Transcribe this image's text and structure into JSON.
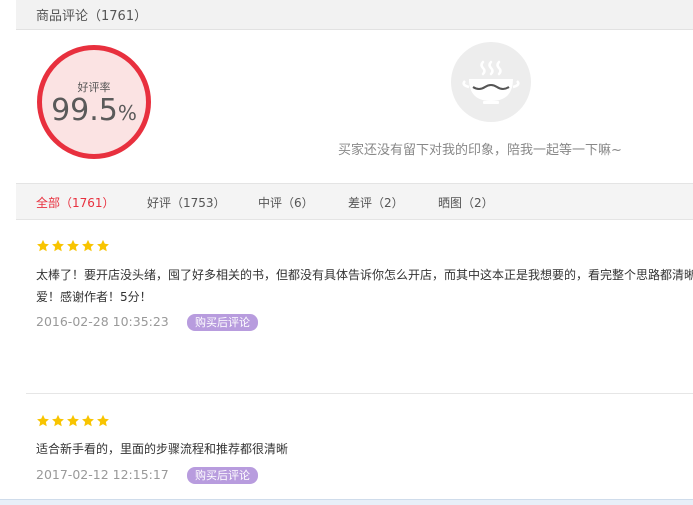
{
  "header": {
    "title": "商品评论（1761）"
  },
  "summary": {
    "rate_label": "好评率",
    "rate_value": "99.5",
    "rate_unit": "%",
    "empty_message": "买家还没有留下对我的印象，陪我一起等一下嘛~",
    "accent_color": "#e8303e"
  },
  "tabs": [
    {
      "label": "全部（1761）",
      "active": true
    },
    {
      "label": "好评（1753）"
    },
    {
      "label": "中评（6）"
    },
    {
      "label": "差评（2）"
    },
    {
      "label": "晒图（2）"
    }
  ],
  "reviews": [
    {
      "stars": 5,
      "text_line1": "太棒了！要开店没头绪，囤了好多相关的书，但都没有具体告诉你怎么开店，而其中这本正是我想要的，看完整个思路都清晰",
      "text_line2": "爱！感谢作者！5分！",
      "date": "2016-02-28 10:35:23",
      "badge": "购买后评论"
    },
    {
      "stars": 5,
      "text_line1": "适合新手看的，里面的步骤流程和推荐都很清晰",
      "date": "2017-02-12 12:15:17",
      "badge": "购买后评论"
    }
  ],
  "icons": {
    "star": "star-icon",
    "empty": "soup-bowl-icon"
  }
}
